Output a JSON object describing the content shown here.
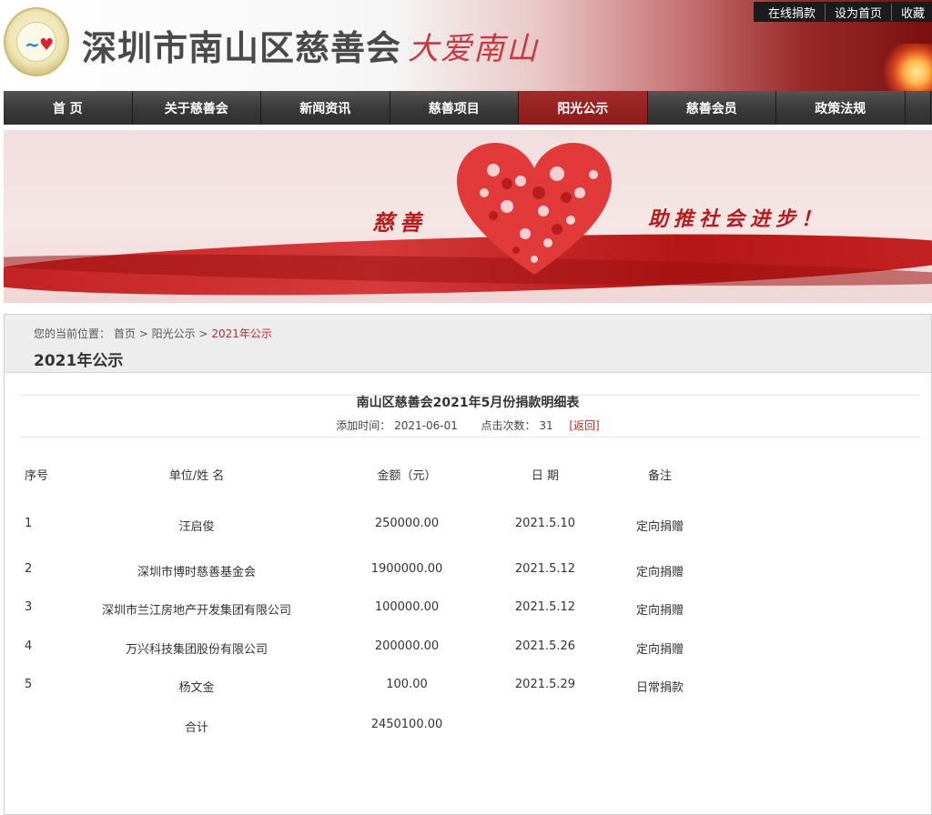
{
  "header": {
    "site_title": "深圳市南山区慈善会",
    "slogan": "大爱南山",
    "top_links": [
      "在线捐款",
      "设为首页",
      "收藏"
    ]
  },
  "nav": {
    "items": [
      "首 页",
      "关于慈善会",
      "新闻资讯",
      "慈善项目",
      "阳光公示",
      "慈善会员",
      "政策法规"
    ],
    "active": "阳光公示"
  },
  "banner": {
    "left_text": "慈善",
    "right_text": "助推社会进步！"
  },
  "breadcrumb": {
    "label": "您的当前位置：",
    "home": "首页",
    "sep": ">",
    "section": "阳光公示",
    "current": "2021年公示"
  },
  "page_title": "2021年公示",
  "article": {
    "title": "南山区慈善会2021年5月份捐款明细表",
    "added_label": "添加时间：",
    "added_value": "2021-06-01",
    "clicks_label": "点击次数：",
    "clicks_value": "31",
    "back": "[返回]"
  },
  "table": {
    "headers": [
      "序号",
      "单位/姓 名",
      "金额（元）",
      "日 期",
      "备注"
    ],
    "rows": [
      [
        "1",
        "汪启俊",
        "250000.00",
        "2021.5.10",
        "定向捐赠"
      ],
      [
        "2",
        "深圳市博时慈善基金会",
        "1900000.00",
        "2021.5.12",
        "定向捐赠"
      ],
      [
        "3",
        "深圳市兰江房地产开发集团有限公司",
        "100000.00",
        "2021.5.12",
        "定向捐赠"
      ],
      [
        "4",
        "万兴科技集团股份有限公司",
        "200000.00",
        "2021.5.26",
        "定向捐赠"
      ],
      [
        "5",
        "杨文金",
        "100.00",
        "2021.5.29",
        "日常捐款"
      ]
    ],
    "total_label": "合计",
    "total_value": "2450100.00"
  }
}
